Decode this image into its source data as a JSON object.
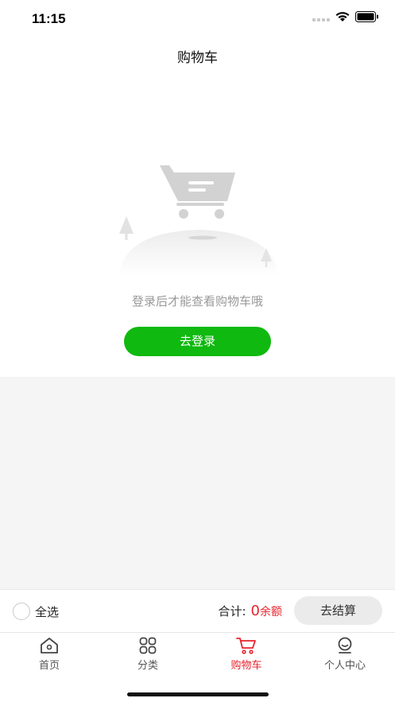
{
  "status_bar": {
    "time": "11:15"
  },
  "nav": {
    "title": "购物车"
  },
  "empty_state": {
    "message": "登录后才能查看购物车哦",
    "login_button": "去登录"
  },
  "footer": {
    "select_all_label": "全选",
    "total_label": "合计:",
    "total_value": "0",
    "total_unit": "余额",
    "checkout_button": "去结算"
  },
  "tabs": [
    {
      "label": "首页",
      "icon": "home-icon",
      "active": false
    },
    {
      "label": "分类",
      "icon": "category-grid-icon",
      "active": false
    },
    {
      "label": "购物车",
      "icon": "cart-icon",
      "active": true
    },
    {
      "label": "个人中心",
      "icon": "profile-icon",
      "active": false
    }
  ],
  "colors": {
    "accent": "#e8232d",
    "login_green": "#0fb90f"
  }
}
